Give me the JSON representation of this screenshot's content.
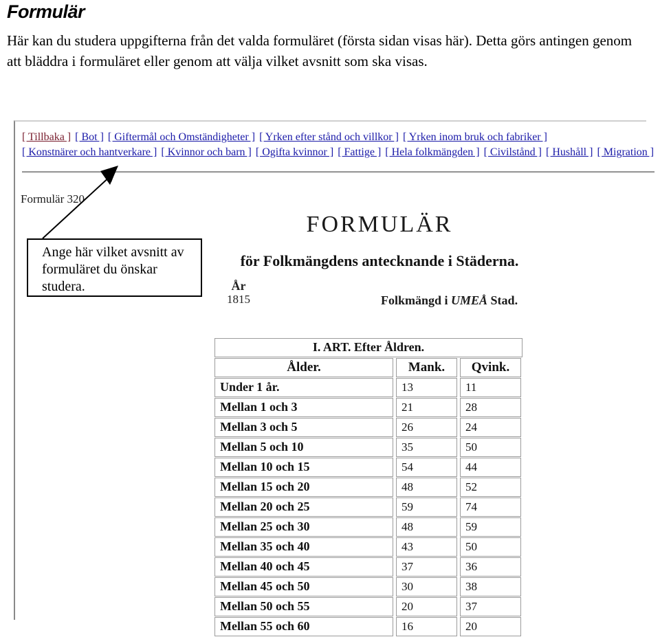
{
  "document": {
    "title": "Formulär",
    "paragraph": "Här kan du studera uppgifterna från det valda formuläret (första sidan visas här). Detta görs antingen genom att bläddra i formuläret eller genom att välja vilket avsnitt som ska visas."
  },
  "screenshot": {
    "nav": {
      "row1": [
        {
          "label": "[ Tillbaka ]",
          "state": "visited"
        },
        {
          "label": "[ Bot ]",
          "state": "link"
        },
        {
          "label": "[ Giftermål och Omständigheter ]",
          "state": "link"
        },
        {
          "label": "[ Yrken efter stånd och villkor ]",
          "state": "link"
        },
        {
          "label": "[ Yrken inom bruk och fabriker ]",
          "state": "link"
        }
      ],
      "row2": [
        {
          "label": "[ Konstnärer och hantverkare ]",
          "state": "link"
        },
        {
          "label": "[ Kvinnor och barn ]",
          "state": "link"
        },
        {
          "label": "[ Ogifta kvinnor ]",
          "state": "link"
        },
        {
          "label": "[ Fattige ]",
          "state": "link"
        },
        {
          "label": "[ Hela folkmängden ]",
          "state": "link"
        },
        {
          "label": "[ Civilstånd ]",
          "state": "link"
        },
        {
          "label": "[ Hushåll ]",
          "state": "link"
        },
        {
          "label": "[ Migration ]",
          "state": "link"
        }
      ]
    },
    "form_number": "Formulär 320",
    "callout": {
      "text": "Ange här vilket avsnitt av formuläret du önskar studera."
    },
    "scan": {
      "main_title": "FORMULÄR",
      "sub_title": "för Folkmängdens antecknande i Städerna.",
      "year_label": "År",
      "year_value": "1815",
      "place_prefix": "Folkmängd i ",
      "place_city": "UMEÅ",
      "place_suffix": " Stad.",
      "table": {
        "caption": "I. ART. Efter Åldren.",
        "headers": [
          "Ålder.",
          "Mank.",
          "Qvink."
        ],
        "rows": [
          {
            "label": "Under 1 år.",
            "mank": "13",
            "qvink": "11"
          },
          {
            "label": "Mellan 1 och 3",
            "mank": "21",
            "qvink": "28"
          },
          {
            "label": "Mellan 3 och 5",
            "mank": "26",
            "qvink": "24"
          },
          {
            "label": "Mellan 5 och 10",
            "mank": "35",
            "qvink": "50"
          },
          {
            "label": "Mellan 10 och 15",
            "mank": "54",
            "qvink": "44"
          },
          {
            "label": "Mellan 15 och 20",
            "mank": "48",
            "qvink": "52"
          },
          {
            "label": "Mellan 20 och 25",
            "mank": "59",
            "qvink": "74"
          },
          {
            "label": "Mellan 25 och 30",
            "mank": "48",
            "qvink": "59"
          },
          {
            "label": "Mellan 35 och 40",
            "mank": "43",
            "qvink": "50"
          },
          {
            "label": "Mellan 40 och 45",
            "mank": "37",
            "qvink": "36"
          },
          {
            "label": "Mellan 45 och 50",
            "mank": "30",
            "qvink": "38"
          },
          {
            "label": "Mellan 50 och 55",
            "mank": "20",
            "qvink": "37"
          },
          {
            "label": "Mellan 55 och 60",
            "mank": "16",
            "qvink": "20"
          }
        ]
      }
    }
  },
  "colors": {
    "link": "#1a1aa8",
    "visited_link": "#7a2030",
    "frame_border": "#888888",
    "table_border": "#9b9b9b"
  }
}
